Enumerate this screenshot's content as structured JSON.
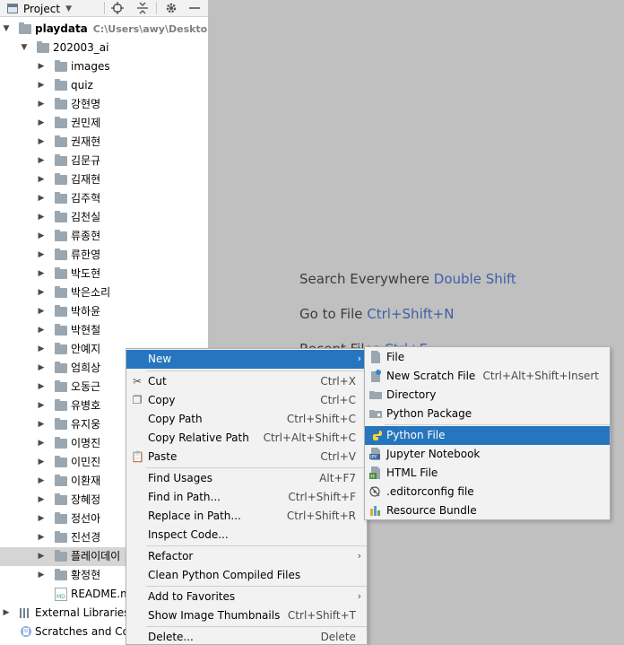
{
  "toolbar": {
    "title": "Project",
    "icons": [
      "window-icon",
      "dropdown-icon",
      "target-icon",
      "collapse-icon",
      "gear-icon",
      "minimize-icon"
    ]
  },
  "tree": {
    "root": {
      "label": "playdata",
      "path": "C:\\Users\\awy\\Desktop\\"
    },
    "project": {
      "label": "202003_ai"
    },
    "folders": [
      "images",
      "quiz",
      "강현명",
      "권민제",
      "권재현",
      "김문규",
      "김재현",
      "김주혁",
      "김천실",
      "류종현",
      "류한영",
      "박도현",
      "박은소리",
      "박하윤",
      "박현철",
      "안예지",
      "엄희상",
      "오동근",
      "유병호",
      "유지웅",
      "이명진",
      "이민진",
      "이환재",
      "장혜정",
      "정선아",
      "진선경",
      "플레이데이",
      "황정현"
    ],
    "readme": "README.m",
    "external": "External Libraries",
    "scratches": "Scratches and Con"
  },
  "editor_hints": {
    "search": {
      "text": "Search Everywhere",
      "key": "Double Shift"
    },
    "goto": {
      "text": "Go to File",
      "key": "Ctrl+Shift+N"
    },
    "recent": {
      "text": "Recent Files",
      "key": "Ctrl+E"
    }
  },
  "context_menu": {
    "new": {
      "label": "New"
    },
    "cut": {
      "label": "Cut",
      "shortcut": "Ctrl+X"
    },
    "copy": {
      "label": "Copy",
      "shortcut": "Ctrl+C"
    },
    "copy_path": {
      "label": "Copy Path",
      "shortcut": "Ctrl+Shift+C"
    },
    "copy_relative_path": {
      "label": "Copy Relative Path",
      "shortcut": "Ctrl+Alt+Shift+C"
    },
    "paste": {
      "label": "Paste",
      "shortcut": "Ctrl+V"
    },
    "find_usages": {
      "label": "Find Usages",
      "shortcut": "Alt+F7"
    },
    "find_in_path": {
      "label": "Find in Path...",
      "shortcut": "Ctrl+Shift+F"
    },
    "replace_in_path": {
      "label": "Replace in Path...",
      "shortcut": "Ctrl+Shift+R"
    },
    "inspect_code": {
      "label": "Inspect Code..."
    },
    "refactor": {
      "label": "Refactor"
    },
    "clean_compiled": {
      "label": "Clean Python Compiled Files"
    },
    "add_favorites": {
      "label": "Add to Favorites"
    },
    "show_thumbnails": {
      "label": "Show Image Thumbnails",
      "shortcut": "Ctrl+Shift+T"
    },
    "delete": {
      "label": "Delete...",
      "shortcut": "Delete"
    }
  },
  "submenu": {
    "file": {
      "label": "File"
    },
    "scratch": {
      "label": "New Scratch File",
      "shortcut": "Ctrl+Alt+Shift+Insert"
    },
    "directory": {
      "label": "Directory"
    },
    "python_package": {
      "label": "Python Package"
    },
    "python_file": {
      "label": "Python File"
    },
    "jupyter": {
      "label": "Jupyter Notebook"
    },
    "html": {
      "label": "HTML File"
    },
    "editorconfig": {
      "label": ".editorconfig file"
    },
    "resource_bundle": {
      "label": "Resource Bundle"
    }
  },
  "colors": {
    "accent": "#2675bf",
    "hint_key": "#3f5fa6",
    "folder": "#9aa7b0",
    "python_blue": "#3776ab",
    "python_yellow": "#ffd43b"
  }
}
